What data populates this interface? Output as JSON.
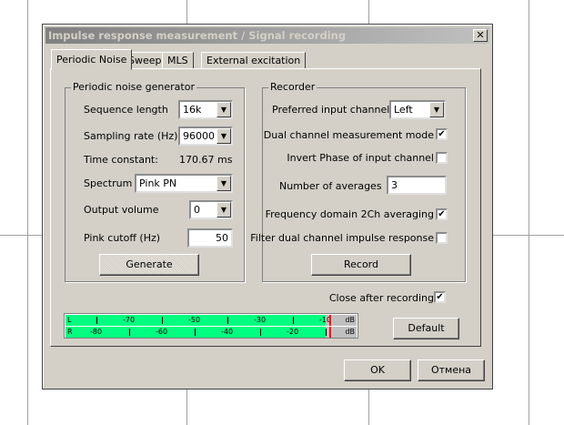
{
  "dialog": {
    "title": "Impulse response measurement / Signal recording",
    "close": "✕"
  },
  "tabs": [
    "Periodic Noise",
    "Sweep",
    "MLS",
    "External excitation"
  ],
  "generator": {
    "legend": "Periodic noise generator",
    "sequence_length_label": "Sequence length",
    "sequence_length": "16k",
    "sampling_rate_label": "Sampling rate (Hz)",
    "sampling_rate": "96000",
    "time_constant_label": "Time constant:",
    "time_constant": "170.67 ms",
    "spectrum_label": "Spectrum",
    "spectrum": "Pink PN",
    "output_volume_label": "Output volume",
    "output_volume": "0",
    "pink_cutoff_label": "Pink cutoff (Hz)",
    "pink_cutoff": "50",
    "generate": "Generate"
  },
  "recorder": {
    "legend": "Recorder",
    "preferred_channel_label": "Preferred input channel",
    "preferred_channel": "Left",
    "dual_channel_label": "Dual channel measurement mode",
    "dual_channel": true,
    "invert_phase_label": "Invert Phase of input channel",
    "invert_phase": false,
    "averages_label": "Number of averages",
    "averages": "3",
    "freq_avg_label": "Frequency domain 2Ch averaging",
    "freq_avg": true,
    "filter_label": "Filter dual channel impulse response",
    "filter": false,
    "record": "Record"
  },
  "close_after_label": "Close after recording",
  "close_after": true,
  "meter": {
    "left_label": "L",
    "right_label": "R",
    "unit": "dB",
    "left_level_db": -10,
    "right_level_db": -10,
    "peak_db": -9,
    "left_ticks": [
      -80,
      -70,
      -60,
      -50,
      -40,
      -30,
      -20,
      -10
    ],
    "left_labels": [
      "-70",
      "-50",
      "-30",
      "-10"
    ],
    "right_ticks": [
      -90,
      -80,
      -70,
      -60,
      -50,
      -40,
      -30,
      -20,
      -10
    ],
    "right_labels": [
      "-80",
      "-60",
      "-40",
      "-20"
    ]
  },
  "buttons": {
    "default": "Default",
    "ok": "OK",
    "cancel": "Отмена"
  }
}
